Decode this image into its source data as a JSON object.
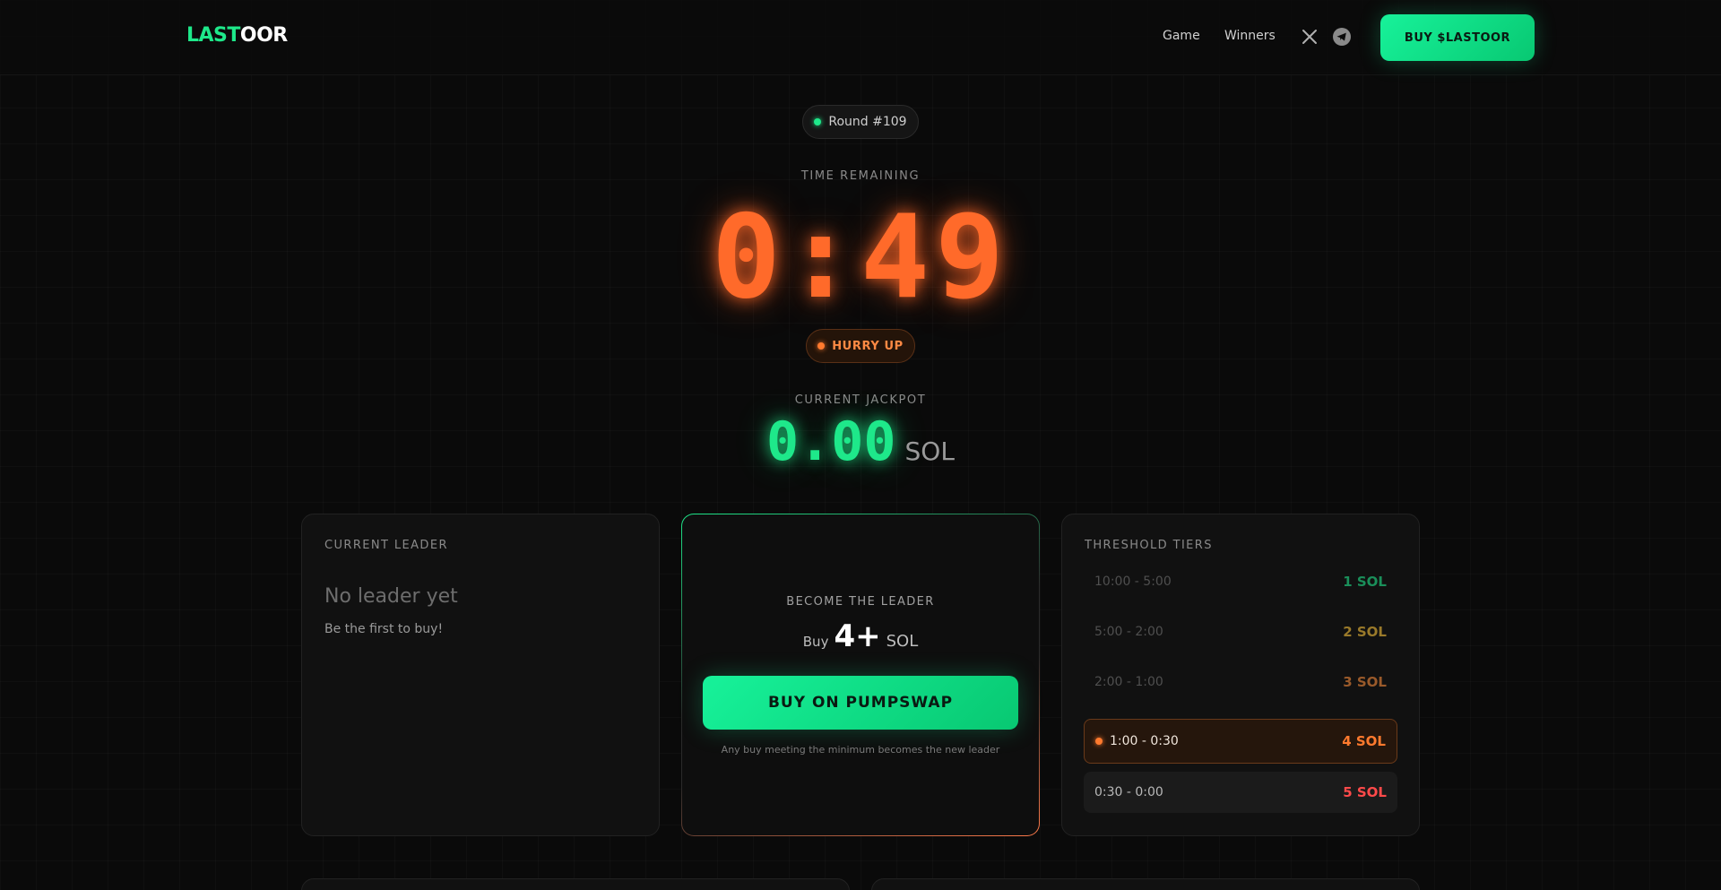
{
  "header": {
    "logo_part1": "LAST",
    "logo_part2": "OOR",
    "nav": {
      "game": "Game",
      "winners": "Winners"
    },
    "social": {
      "x_icon": "x-icon",
      "telegram_icon": "telegram-icon"
    },
    "buy_token_label": "BUY $LASTOOR"
  },
  "round": {
    "label": "Round #109"
  },
  "timer": {
    "caption": "TIME REMAINING",
    "value": "0:49"
  },
  "status": {
    "label": "HURRY UP"
  },
  "jackpot": {
    "caption": "CURRENT JACKPOT",
    "amount": "0.00",
    "unit": "SOL"
  },
  "leader_card": {
    "title": "CURRENT LEADER",
    "name": "No leader yet",
    "hint": "Be the first to buy!"
  },
  "become_card": {
    "title": "BECOME THE LEADER",
    "buy_prefix": "Buy",
    "min_amount": "4+",
    "unit": "SOL",
    "button_label": "BUY ON PUMPSWAP",
    "note": "Any buy meeting the minimum becomes the new leader"
  },
  "tiers_card": {
    "title": "THRESHOLD TIERS",
    "tiers": [
      {
        "range": "10:00 - 5:00",
        "amount": "1 SOL"
      },
      {
        "range": "5:00 - 2:00",
        "amount": "2 SOL"
      },
      {
        "range": "2:00 - 1:00",
        "amount": "3 SOL"
      },
      {
        "range": "1:00 - 0:30",
        "amount": "4 SOL"
      },
      {
        "range": "0:30 - 0:00",
        "amount": "5 SOL"
      }
    ],
    "active_index": 3
  },
  "colors": {
    "accent_green": "#1ee88a",
    "accent_orange": "#ff6a2a",
    "danger_red": "#ff4a4a",
    "background": "#0a0a0a"
  }
}
